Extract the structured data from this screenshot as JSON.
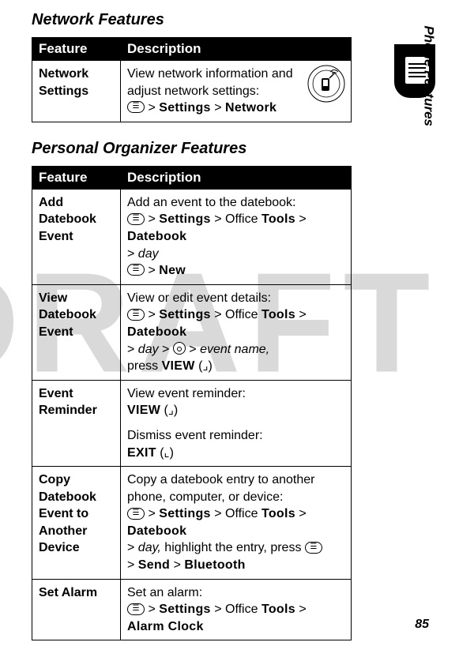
{
  "watermark": "DRAFT",
  "page_number": "85",
  "side_label": "Phone Features",
  "sections": {
    "network": {
      "title": "Network Features",
      "columns": {
        "feature": "Feature",
        "description": "Description"
      },
      "rows": {
        "network_settings": {
          "feature": "Network Settings",
          "text1": "View network information and adjust network settings:",
          "menu_glyph": "☰",
          "sep1": " > ",
          "settings": "Settings",
          "sep2": " > ",
          "network": "Network"
        }
      }
    },
    "organizer": {
      "title": "Personal Organizer Features",
      "columns": {
        "feature": "Feature",
        "description": "Description"
      },
      "rows": {
        "add_event": {
          "feature": "Add Datebook Event",
          "text1": "Add an event to the datebook:",
          "menu_glyph": "☰",
          "sep1": " > ",
          "settings": "Settings",
          "sep2": " > Office ",
          "tools": "Tools",
          "sep3": " > ",
          "datebook": "Datebook",
          "sep4": " > ",
          "day": "day",
          "menu_glyph2": "☰",
          "sep5": " > ",
          "new": "New"
        },
        "view_event": {
          "feature": "View Datebook Event",
          "text1": "View or edit event details:",
          "menu_glyph": "☰",
          "sep1": " > ",
          "settings": "Settings",
          "sep2": " > Office ",
          "tools": "Tools",
          "sep3": " > ",
          "datebook": "Datebook",
          "sep4": " > ",
          "day": "day",
          "sep5": " > ",
          "sep6": " > ",
          "event_name": "event name,",
          "press": "press ",
          "view": "VIEW",
          "paren_open": " (",
          "right_soft": "⌟",
          "paren_close": ")"
        },
        "reminder": {
          "feature": "Event Reminder",
          "text1": "View event reminder:",
          "view": "VIEW",
          "paren_open1": " (",
          "right_soft": "⌟",
          "paren_close1": ")",
          "text2": "Dismiss event reminder:",
          "exit": "EXIT",
          "paren_open2": " (",
          "left_soft": "⌞",
          "paren_close2": ")"
        },
        "copy": {
          "feature": "Copy Datebook Event to Another Device",
          "text1": "Copy a datebook entry to another phone, computer, or device:",
          "menu_glyph": "☰",
          "sep1": " > ",
          "settings": "Settings",
          "sep2": " > Office ",
          "tools": "Tools",
          "sep3": " > ",
          "datebook": "Datebook",
          "sep4": " > ",
          "day": "day,",
          "highlight": " highlight the entry, press ",
          "menu_glyph2": "☰",
          "sep5": " > ",
          "send": "Send",
          "sep6": " > ",
          "bluetooth": "Bluetooth"
        },
        "alarm": {
          "feature": "Set Alarm",
          "text1": "Set an alarm:",
          "menu_glyph": "☰",
          "sep1": " > ",
          "settings": "Settings",
          "sep2": " > Office ",
          "tools": "Tools",
          "sep3": " > ",
          "alarm_clock": "Alarm Clock"
        }
      }
    }
  }
}
